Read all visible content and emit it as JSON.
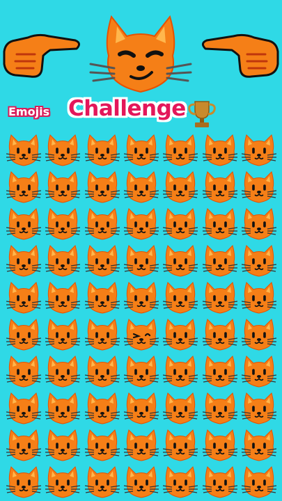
{
  "title": {
    "small": "Emojis",
    "big": "Challenge"
  },
  "icons": {
    "hero": "smirking-cat-icon",
    "left_pointer": "pointing-right-hand-icon",
    "right_pointer": "pointing-left-hand-icon",
    "trophy": "trophy-icon",
    "grid_item": "cat-face-icon",
    "odd_item": "winking-cat-face-icon"
  },
  "colors": {
    "background": "#2fd9e6",
    "cat": "#f57f17",
    "cat_dark": "#bf360c",
    "title_pink": "#e3175a"
  },
  "grid": {
    "rows": 10,
    "columns": 7,
    "odd_cell": {
      "row": 5,
      "column": 3
    }
  }
}
